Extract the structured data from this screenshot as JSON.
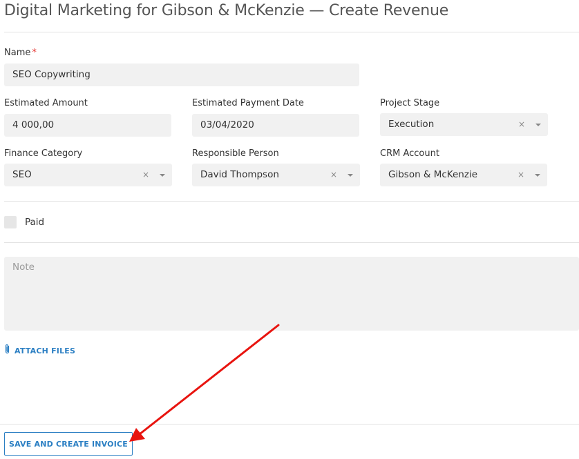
{
  "page": {
    "title": "Digital Marketing for Gibson & McKenzie — Create Revenue"
  },
  "form": {
    "name": {
      "label": "Name",
      "required_mark": "*",
      "value": "SEO Copywriting"
    },
    "estimated_amount": {
      "label": "Estimated Amount",
      "value": "4 000,00"
    },
    "estimated_payment_date": {
      "label": "Estimated Payment Date",
      "value": "03/04/2020"
    },
    "project_stage": {
      "label": "Project Stage",
      "value": "Execution",
      "clear_glyph": "×"
    },
    "finance_category": {
      "label": "Finance Category",
      "value": "SEO",
      "clear_glyph": "×"
    },
    "responsible_person": {
      "label": "Responsible Person",
      "value": "David Thompson",
      "clear_glyph": "×"
    },
    "crm_account": {
      "label": "CRM Account",
      "value": "Gibson & McKenzie",
      "clear_glyph": "×"
    },
    "paid": {
      "label": "Paid",
      "checked": false
    },
    "note": {
      "placeholder": "Note",
      "value": ""
    }
  },
  "attach": {
    "label": "ATTACH FILES",
    "icon": "paperclip-icon"
  },
  "footer": {
    "save_button_label": "SAVE AND CREATE INVOICE"
  },
  "annotation": {
    "arrow_color": "#e8140f",
    "meaning": "arrow pointing to save button"
  },
  "colors": {
    "accent": "#2b7fc3",
    "field_bg": "#f1f1f1",
    "required": "#e53935"
  }
}
